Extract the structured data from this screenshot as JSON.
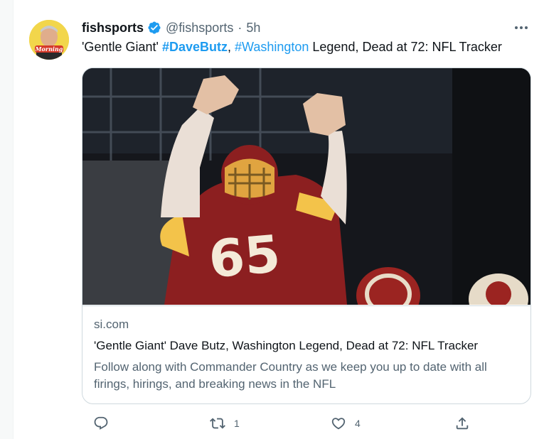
{
  "tweet": {
    "author_name": "fishsports",
    "author_handle": "@fishsports",
    "separator": "·",
    "time": "5h",
    "text_parts": [
      "'Gentle Giant' ",
      "#DaveButz",
      ", ",
      "#Washington",
      " Legend, Dead at 72: NFL Tracker"
    ],
    "avatar_text": "Morning"
  },
  "link_card": {
    "domain": "si.com",
    "title": "'Gentle Giant' Dave Butz, Washington Legend, Dead at 72: NFL Tracker",
    "description": "Follow along with Commander Country as we keep you up to date with all firings, hirings, and breaking news in the NFL",
    "photo_jersey_number": "65"
  },
  "actions": {
    "retweets": "1",
    "likes": "4"
  },
  "colors": {
    "link": "#1d9bf0",
    "verified": "#1d9bf0",
    "secondary_text": "#536471",
    "border": "#cfd9de"
  },
  "icons": {
    "more": "more-icon",
    "verified": "verified-badge-icon",
    "reply": "reply-icon",
    "retweet": "retweet-icon",
    "like": "like-icon",
    "share": "share-icon"
  }
}
